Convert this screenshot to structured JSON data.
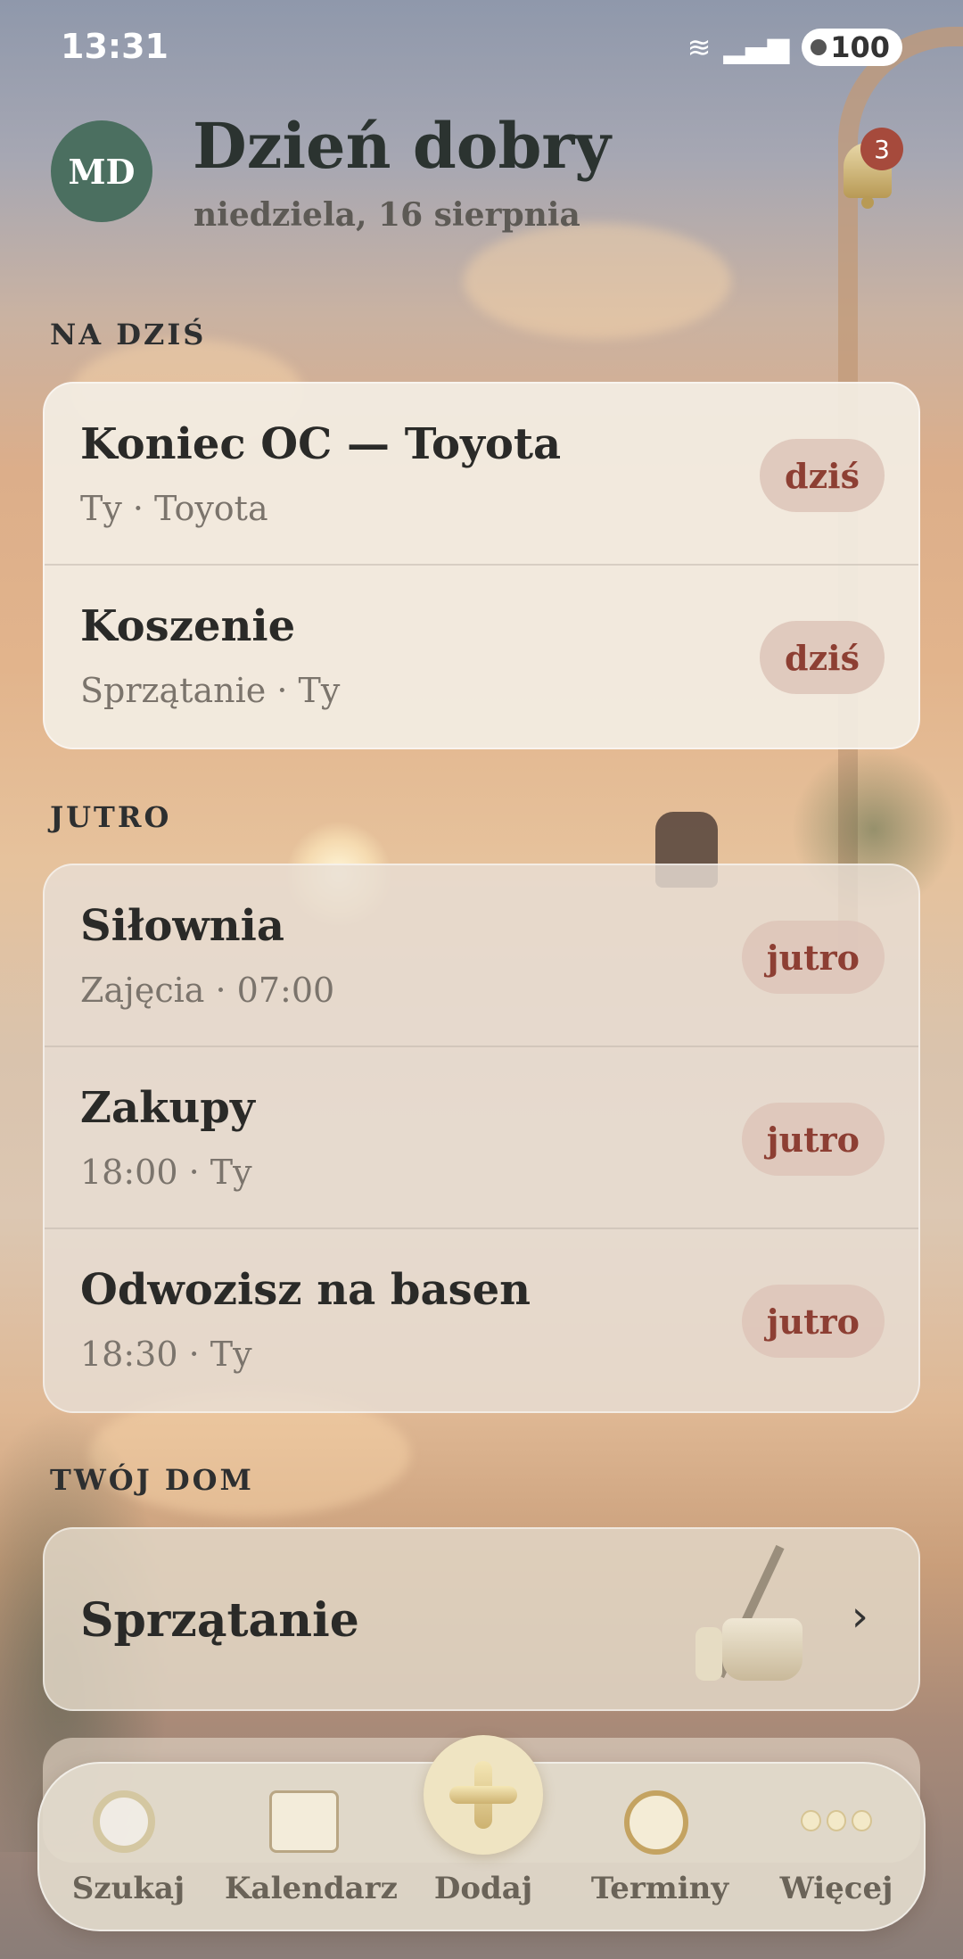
{
  "status_bar": {
    "time": "13:31",
    "battery": "100"
  },
  "header": {
    "avatar_initials": "MD",
    "greeting": "Dzień dobry",
    "date": "niedziela, 16 sierpnia",
    "notifications_count": "3"
  },
  "sections": {
    "today": {
      "title": "NA DZIŚ",
      "items": [
        {
          "title": "Koniec OC — Toyota",
          "subtitle": "Ty · Toyota",
          "badge": "dziś"
        },
        {
          "title": "Koszenie",
          "subtitle": "Sprzątanie · Ty",
          "badge": "dziś"
        }
      ]
    },
    "tomorrow": {
      "title": "JUTRO",
      "items": [
        {
          "title": "Siłownia",
          "subtitle": "Zajęcia · 07:00",
          "badge": "jutro"
        },
        {
          "title": "Zakupy",
          "subtitle": "18:00 · Ty",
          "badge": "jutro"
        },
        {
          "title": "Odwozisz na basen",
          "subtitle": "18:30 · Ty",
          "badge": "jutro"
        }
      ]
    },
    "home": {
      "title": "TWÓJ DOM",
      "card_title": "Sprzątanie"
    }
  },
  "tab_bar": {
    "search": "Szukaj",
    "calendar": "Kalendarz",
    "add": "Dodaj",
    "deadlines": "Terminy",
    "more": "Więcej"
  }
}
